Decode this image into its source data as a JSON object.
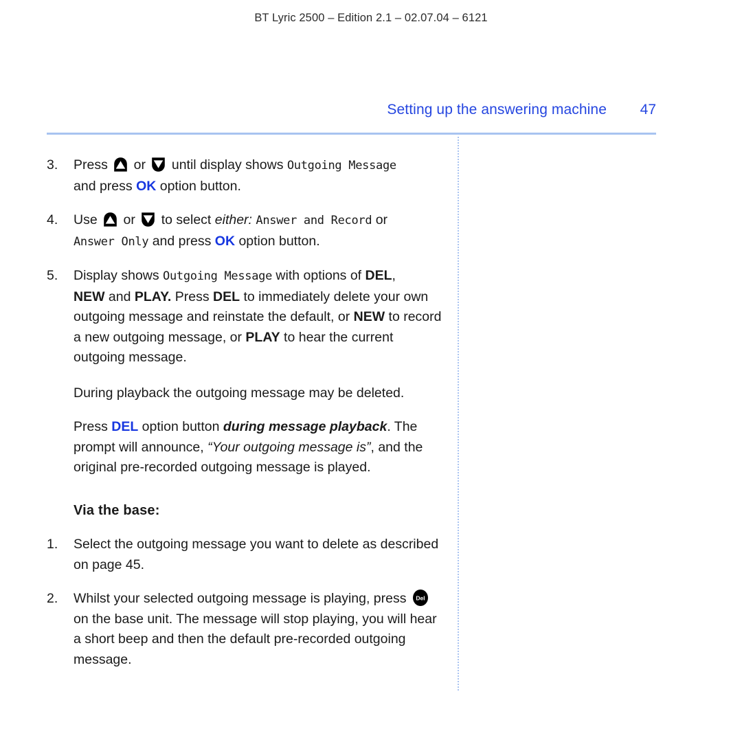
{
  "header": {
    "running_head": "BT Lyric 2500 – Edition 2.1 – 02.07.04 – 6121",
    "section_title": "Setting up the answering machine",
    "page_number": "47"
  },
  "colors": {
    "accent_blue": "#2546e0",
    "link_blue": "#1636e0",
    "rule_blue": "#a8c3f0"
  },
  "icons": {
    "up_arrow_key": "up-arrow-key-icon",
    "down_arrow_key": "down-arrow-key-icon",
    "del_key": "del-key-icon",
    "del_key_label": "Del"
  },
  "content": {
    "step3": {
      "num": "3.",
      "t1": "Press ",
      "t2": " or ",
      "t3": " until display shows ",
      "lcd1": "Outgoing Message",
      "t4": "and press ",
      "ok": "OK",
      "t5": " option button."
    },
    "step4": {
      "num": "4.",
      "t1": "Use ",
      "t2": " or ",
      "t3": " to select ",
      "either": "either:",
      "lcd1": "Answer and Record",
      "t4": " or",
      "lcd2": "Answer Only",
      "t5": " and press ",
      "ok": "OK",
      "t6": " option button."
    },
    "step5": {
      "num": "5.",
      "t1": "Display shows ",
      "lcd1": "Outgoing Message",
      "t2": " with options of ",
      "del1": "DEL",
      "t3": ",",
      "new1": "NEW",
      "t4": " and ",
      "play1": "PLAY.",
      "t5": " Press ",
      "del2": "DEL",
      "t6": " to immediately delete your own outgoing message and reinstate the default, or ",
      "new2": "NEW",
      "t7": " to record a new outgoing message, or ",
      "play2": "PLAY",
      "t8": " to hear the current outgoing message."
    },
    "para_playback": "During playback the outgoing message may be deleted.",
    "para_del": {
      "t1": "Press ",
      "del": "DEL",
      "t2": " option button ",
      "emph": "during message playback",
      "t3": ". The prompt will announce, ",
      "quote": "“Your outgoing message is”",
      "t4": ", and the original pre-recorded outgoing message is played."
    },
    "subhead_via_base": "Via the base:",
    "base_step1": {
      "num": "1.",
      "text": "Select the outgoing message you want to delete as described on page 45."
    },
    "base_step2": {
      "num": "2.",
      "t1": "Whilst your selected outgoing message is playing, press ",
      "t2": " on the base unit. The message will stop playing, you will hear a short beep and then the default pre-recorded outgoing message."
    }
  }
}
